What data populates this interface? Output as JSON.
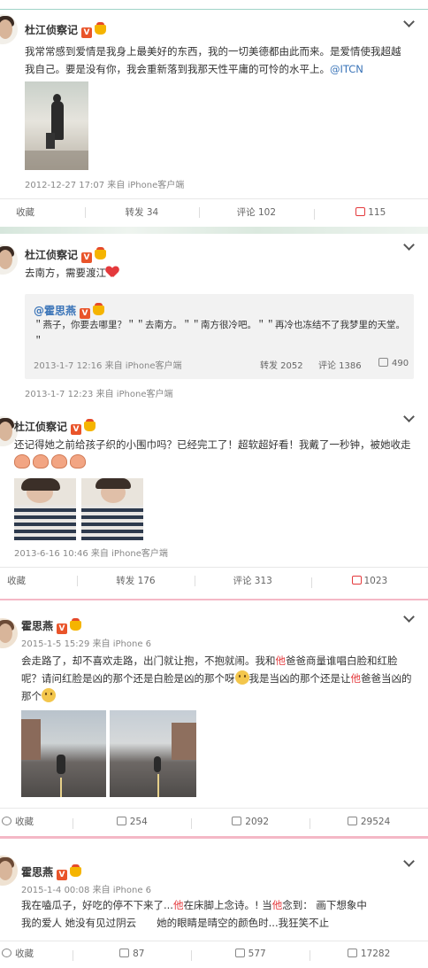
{
  "posts": {
    "p1": {
      "user": "杜江侦察记",
      "text": "我常常感到爱情是我身上最美好的东西，我的一切美德都由此而来。是爱情使我超越我自己。要是没有你，我会重新落到我那天性平庸的可怜的水平上。",
      "mention": "@ITCN",
      "meta": "2012-12-27 17:07 来自 iPhone客户端",
      "actions": {
        "collect": "收藏",
        "repost": "转发 34",
        "comment": "评论 102",
        "like": "115"
      }
    },
    "p2": {
      "user": "杜江侦察记",
      "text": "去南方，需要渡江",
      "quote": {
        "user": "@霍思燕",
        "text": "＂燕子，你要去哪里？＂＂去南方。＂＂南方很冷吧。＂＂再冷也冻结不了我梦里的天堂。＂",
        "meta": "2013-1-7 12:16 来自 iPhone客户端",
        "repost": "转发 2052",
        "comment": "评论 1386",
        "like": "490"
      },
      "meta": "2013-1-7 12:23 来自 iPhone客户端"
    },
    "p3": {
      "user": "杜江侦察记",
      "text": "还记得她之前给孩子织的小围巾吗？已经完工了！超软超好看！我戴了一秒钟，被她收走",
      "meta": "2013-6-16 10:46 来自 iPhone客户端",
      "actions": {
        "collect": "收藏",
        "repost": "转发 176",
        "comment": "评论 313",
        "like": "1023"
      }
    },
    "p4": {
      "user": "霍思燕",
      "meta": "2015-1-5 15:29 来自 iPhone 6",
      "text_a": "会走路了，却不喜欢走路，出门就让抱，不抱就闹。我和",
      "he": "他",
      "text_b": "爸爸商量谁唱白脸和红脸呢？请问红脸是凶的那个还是白脸是凶的那个呀",
      "text_c": "我是当凶的那个还是让",
      "text_d": "爸爸当凶的那个",
      "actions": {
        "collect": "收藏",
        "repost": "254",
        "comment": "2092",
        "like": "29524"
      }
    },
    "p5": {
      "user": "霍思燕",
      "meta": "2015-1-4 00:08 来自 iPhone 6",
      "text_a": "我在嗑瓜子，好吃的停不下来了...",
      "he": "他",
      "text_b": "在床脚上念诗。! 当",
      "text_c": "念到： 画下想象中",
      "text_d": "我的爱人 她没有见过阴云　　她的眼睛是晴空的颜色时...我狂笑不止",
      "actions": {
        "collect": "收藏",
        "repost": "87",
        "comment": "577",
        "like": "17282"
      }
    }
  },
  "colors": {
    "link": "#3a74b8",
    "accent": "#e4393c",
    "divider_teal": "#9fd3c7",
    "divider_pink": "#f4b8c6"
  }
}
